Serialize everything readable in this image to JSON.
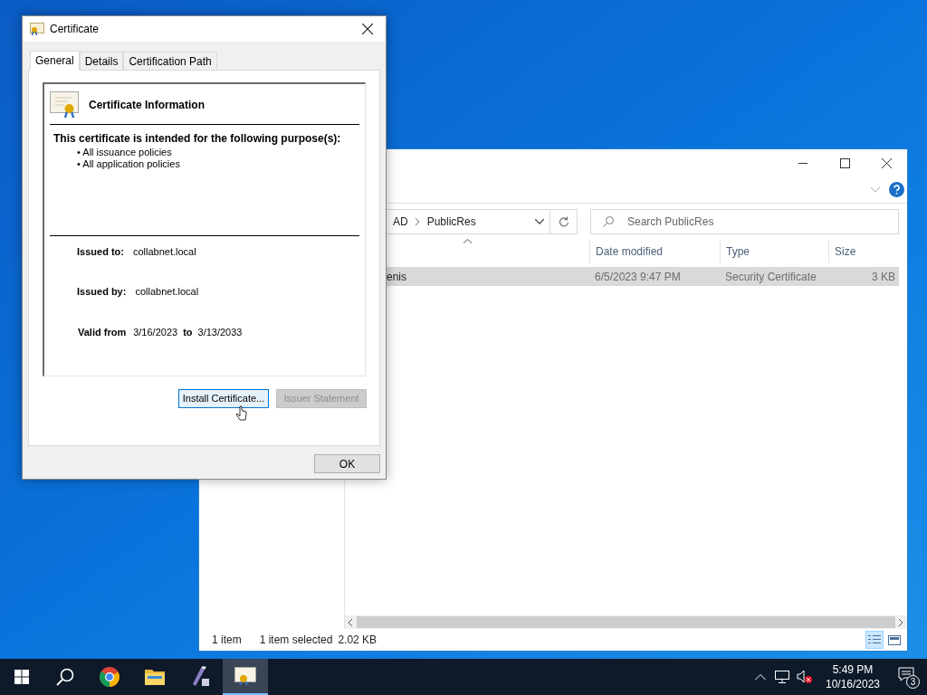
{
  "explorer": {
    "address": [
      "AD",
      "PublicRes"
    ],
    "search": {
      "placeholder": "Search PublicRes"
    },
    "columns": [
      "Date modified",
      "Type",
      "Size"
    ],
    "rows": [
      {
        "name": "enis",
        "date": "6/5/2023 9:47 PM",
        "type": "Security Certificate",
        "size": "3 KB",
        "selected": true
      }
    ],
    "status_bar": {
      "count": "1 item",
      "selection": "1 item selected",
      "size": "2.02 KB"
    },
    "views": [
      {
        "kind": "details",
        "selected": true
      },
      {
        "kind": "tiles",
        "selected": false
      }
    ]
  },
  "dialog": {
    "title": "Certificate",
    "tabs": [
      {
        "label": "General",
        "selected": true
      },
      {
        "label": "Details",
        "selected": false
      },
      {
        "label": "Certification Path",
        "selected": false
      }
    ],
    "heading": "Certificate Information",
    "purpose_heading": "This certificate is intended for the following purpose(s):",
    "purposes": [
      "• All issuance policies",
      "• All application policies"
    ],
    "fields": [
      {
        "label": "Issued to:",
        "value": "collabnet.local"
      },
      {
        "label": "Issued by:",
        "value": "collabnet.local"
      }
    ],
    "validity": {
      "label": "Valid from",
      "from": "3/16/2023",
      "to_label": "to",
      "to": "3/13/2033"
    },
    "buttons": [
      {
        "label": "Install Certificate...",
        "hovered": true,
        "disabled": false
      },
      {
        "label": "Issuer Statement",
        "disabled": true
      }
    ],
    "ok": "OK"
  },
  "taskbar": {
    "apps": [
      {
        "kind": "chrome",
        "selected": false
      },
      {
        "kind": "folder",
        "selected": false
      },
      {
        "kind": "stylus",
        "selected": false
      },
      {
        "kind": "certificate",
        "selected": true
      }
    ],
    "time": "5:49 PM",
    "date": "10/16/2023",
    "notifications": "3"
  }
}
